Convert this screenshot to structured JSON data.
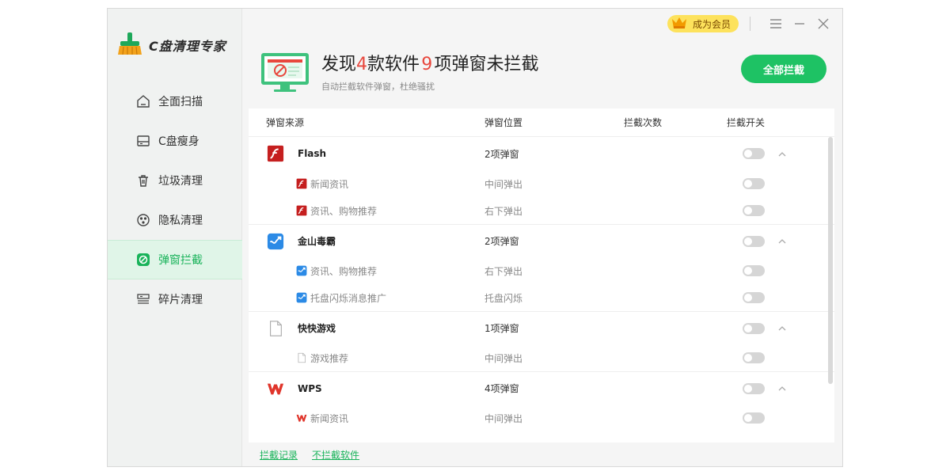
{
  "app": {
    "title": "C盘清理专家"
  },
  "sidebar": {
    "items": [
      {
        "label": "全面扫描",
        "icon": "home-icon",
        "active": false
      },
      {
        "label": "C盘瘦身",
        "icon": "drive-icon",
        "active": false
      },
      {
        "label": "垃圾清理",
        "icon": "trash-icon",
        "active": false
      },
      {
        "label": "隐私清理",
        "icon": "privacy-icon",
        "active": false
      },
      {
        "label": "弹窗拦截",
        "icon": "block-icon",
        "active": true
      },
      {
        "label": "碎片清理",
        "icon": "defrag-icon",
        "active": false
      }
    ]
  },
  "topbar": {
    "member_label": "成为会员"
  },
  "header": {
    "prefix": "发现",
    "software_count": "4",
    "mid": "款软件",
    "popup_count": "9",
    "suffix": "项弹窗未拦截",
    "subtitle": "自动拦截软件弹窗，杜绝骚扰",
    "block_all_label": "全部拦截"
  },
  "table": {
    "headers": {
      "source": "弹窗来源",
      "position": "弹窗位置",
      "count": "拦截次数",
      "switch": "拦截开关"
    },
    "groups": [
      {
        "name": "Flash",
        "icon": "flash-icon",
        "summary": "2项弹窗",
        "items": [
          {
            "name": "新闻资讯",
            "pos": "中间弹出"
          },
          {
            "name": "资讯、购物推荐",
            "pos": "右下弹出"
          }
        ]
      },
      {
        "name": "金山毒霸",
        "icon": "duba-icon",
        "summary": "2项弹窗",
        "items": [
          {
            "name": "资讯、购物推荐",
            "pos": "右下弹出"
          },
          {
            "name": "托盘闪烁消息推广",
            "pos": "托盘闪烁"
          }
        ]
      },
      {
        "name": "快快游戏",
        "icon": "file-icon",
        "summary": "1项弹窗",
        "items": [
          {
            "name": "游戏推荐",
            "pos": "中间弹出"
          }
        ]
      },
      {
        "name": "WPS",
        "icon": "wps-icon",
        "summary": "4项弹窗",
        "items": [
          {
            "name": "新闻资讯",
            "pos": "中间弹出"
          }
        ]
      }
    ]
  },
  "footer": {
    "log_link": "拦截记录",
    "exclude_link": "不拦截软件"
  },
  "colors": {
    "accent": "#1ec264",
    "highlight": "#e8473d",
    "member": "#fde25c"
  }
}
